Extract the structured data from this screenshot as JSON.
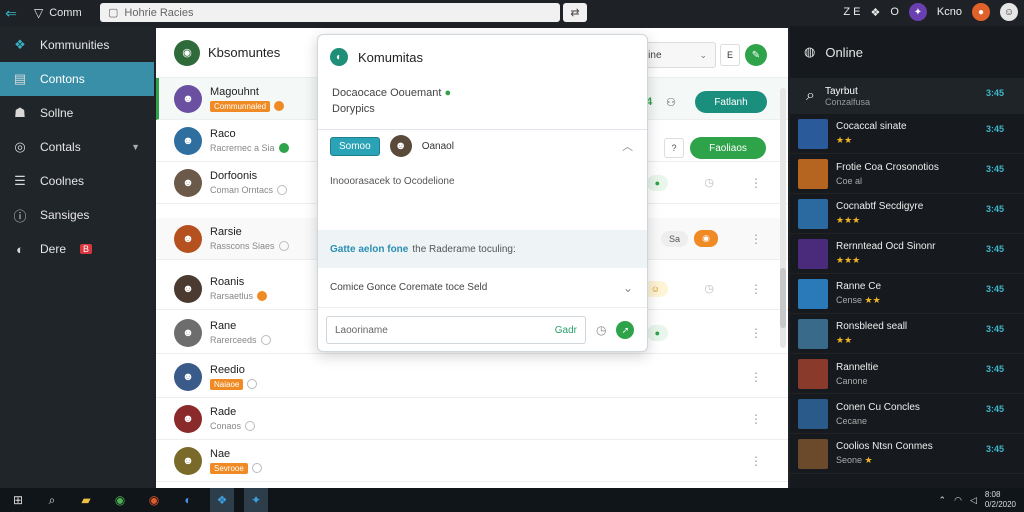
{
  "topbar": {
    "brand": "Comm",
    "address": "Hohrie Racies",
    "user_name": "Kcno",
    "zoom_label": "O",
    "tag_text": "Z E"
  },
  "nav": [
    {
      "label": "Kommunities",
      "icon": "layers-icon",
      "active": false
    },
    {
      "label": "Contons",
      "icon": "contacts-icon",
      "active": true
    },
    {
      "label": "Sollne",
      "icon": "people-icon",
      "active": false
    },
    {
      "label": "Contals",
      "icon": "compass-icon",
      "active": false
    },
    {
      "label": "Coolnes",
      "icon": "list-icon",
      "active": false
    },
    {
      "label": "Sansiges",
      "icon": "info-icon",
      "active": false
    },
    {
      "label": "Dere",
      "icon": "globe-icon",
      "active": false,
      "badge": "B"
    }
  ],
  "main": {
    "title": "Kbsomuntes",
    "filter_label": "Sonitine",
    "filter_square": "E",
    "counter": "24",
    "action_primary": "Fatlanh",
    "action_secondary": "Faoliaos",
    "rows": [
      {
        "name": "Magouhnt",
        "sub": "Communnaled",
        "tag": true,
        "color": "#6b4fa0"
      },
      {
        "name": "Raco",
        "sub": "Racrernec a Sia",
        "tag": false,
        "color": "#2f6fa0"
      },
      {
        "name": "Dorfoonis",
        "sub": "Coman Orntacs",
        "tag": false,
        "color": "#6b5a4a"
      },
      {
        "name": "Rarsie",
        "sub": "Rasscons Siaes",
        "tag": false,
        "color": "#b5511f",
        "pill": "Sa"
      },
      {
        "name": "Roanis",
        "sub": "Rarsaetlus",
        "tag": false,
        "color": "#4a3a30"
      },
      {
        "name": "Rane",
        "sub": "Rarerceeds",
        "tag": false,
        "color": "#6d6d6d"
      },
      {
        "name": "Reedio",
        "sub": "Naiaoe",
        "tag": true,
        "color": "#3a5a8a"
      },
      {
        "name": "Rade",
        "sub": "Conaos",
        "tag": false,
        "color": "#8a2a2a"
      },
      {
        "name": "Nae",
        "sub": "Sevrooe",
        "tag": true,
        "color": "#7a6a2a"
      }
    ]
  },
  "popup": {
    "title": "Komumitas",
    "desc_line1": "Docaocace Oouemant",
    "desc_line2": "Dorypics",
    "sub_button": "Somoo",
    "sub_user": "Oanaol",
    "body_text": "Inooorasacek to Ocodelione",
    "notice_bold": "Gatte aelon fone",
    "notice_rest": "the Raderame toculing:",
    "setting_text": "Comice Gonce Coremate toce Seld",
    "input_placeholder": "Laooriname",
    "input_send": "Gadr"
  },
  "online": {
    "title": "Online",
    "search_title": "Tayrbut",
    "search_sub": "Conzalfusa",
    "search_time": "3:45",
    "items": [
      {
        "title": "Cocaccal sinate",
        "sub": "",
        "stars": "★★",
        "time": "3:45",
        "color": "#2a5a9a"
      },
      {
        "title": "Frotie Coa Crosonotios",
        "sub": "Coe al",
        "stars": "",
        "time": "3:45",
        "color": "#b5651f"
      },
      {
        "title": "Cocnabtf Secdigyre",
        "sub": "",
        "stars": "★★★",
        "time": "3:45",
        "color": "#2a6aa0"
      },
      {
        "title": "Rernntead Ocd Sinonr",
        "sub": "",
        "stars": "★★★",
        "time": "3:45",
        "color": "#4a2a7a"
      },
      {
        "title": "Ranne Ce",
        "sub": "Cense",
        "stars": "★★",
        "time": "3:45",
        "color": "#2a7aba"
      },
      {
        "title": "Ronsbleed seall",
        "sub": "",
        "stars": "★★",
        "time": "3:45",
        "color": "#3a6a8a"
      },
      {
        "title": "Ranneltie",
        "sub": "Canone",
        "stars": "",
        "time": "3:45",
        "color": "#8a3a2a"
      },
      {
        "title": "Conen Cu Concles",
        "sub": "Cecane",
        "stars": "",
        "time": "3:45",
        "color": "#2a5a8a"
      },
      {
        "title": "Coolios Ntsn Conmes",
        "sub": "Seone",
        "stars": "★",
        "time": "3:45",
        "color": "#6a4a2a"
      }
    ]
  },
  "taskbar": {
    "time": "8:08",
    "date": "0/2/2020"
  }
}
